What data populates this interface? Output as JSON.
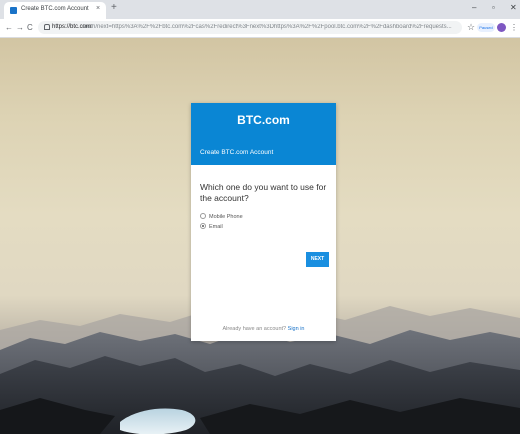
{
  "browser": {
    "tab_title": "Create BTC.com Account",
    "tab_close": "×",
    "new_tab": "+",
    "window_controls": {
      "minimize": "–",
      "restore": "▫",
      "close": "✕"
    },
    "nav": {
      "back": "←",
      "forward": "→",
      "reload": "C"
    },
    "url_host": "https://btc.com",
    "url_rest": "/auth/next=https%3A%2F%2Fbtc.com%2Fcas%2Fredirect%3Fnext%3Dhttps%3A%2F%2Fpool.btc.com%2F%2Fdashboard%2Frequests...",
    "profile_label": "Paused",
    "star": "☆",
    "menu": "⋮"
  },
  "card": {
    "brand": "BTC.com",
    "subtitle": "Create BTC.com Account",
    "question": "Which one do you want to use for the account?",
    "options": [
      {
        "label": "Mobile Phone",
        "selected": false
      },
      {
        "label": "Email",
        "selected": true
      }
    ],
    "next_label": "NEXT",
    "footer_text": "Already have an account?",
    "footer_link": "Sign in"
  },
  "colors": {
    "header_blue": "#0a86d4",
    "button_blue": "#1a8fe0",
    "link_blue": "#1a73c8"
  }
}
